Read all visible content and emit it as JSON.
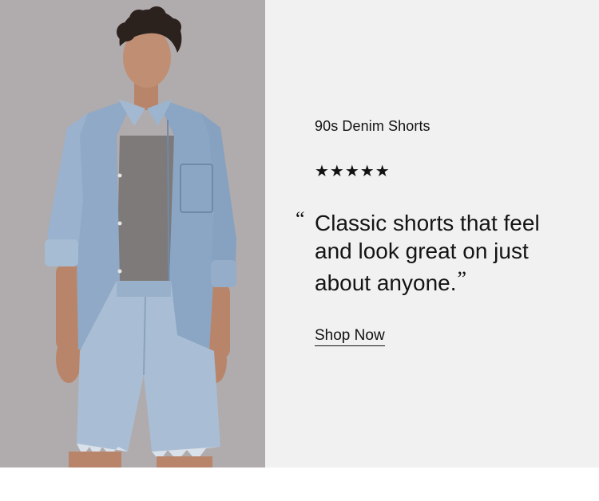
{
  "promo": {
    "image": {
      "icon": "model-photo",
      "subject": "Man wearing light-wash denim shirt and 90s denim shorts"
    },
    "product_name": "90s Denim Shorts",
    "rating": {
      "stars": "★★★★★",
      "value": 5,
      "max": 5
    },
    "quote": {
      "open_mark": "“",
      "text": "Classic shorts that feel and look great on just about anyone.",
      "close_mark": "”"
    },
    "cta_label": "Shop Now"
  },
  "colors": {
    "panel_background": "#f1f1f1",
    "photo_background": "#b3aeb0",
    "text": "#141414"
  }
}
